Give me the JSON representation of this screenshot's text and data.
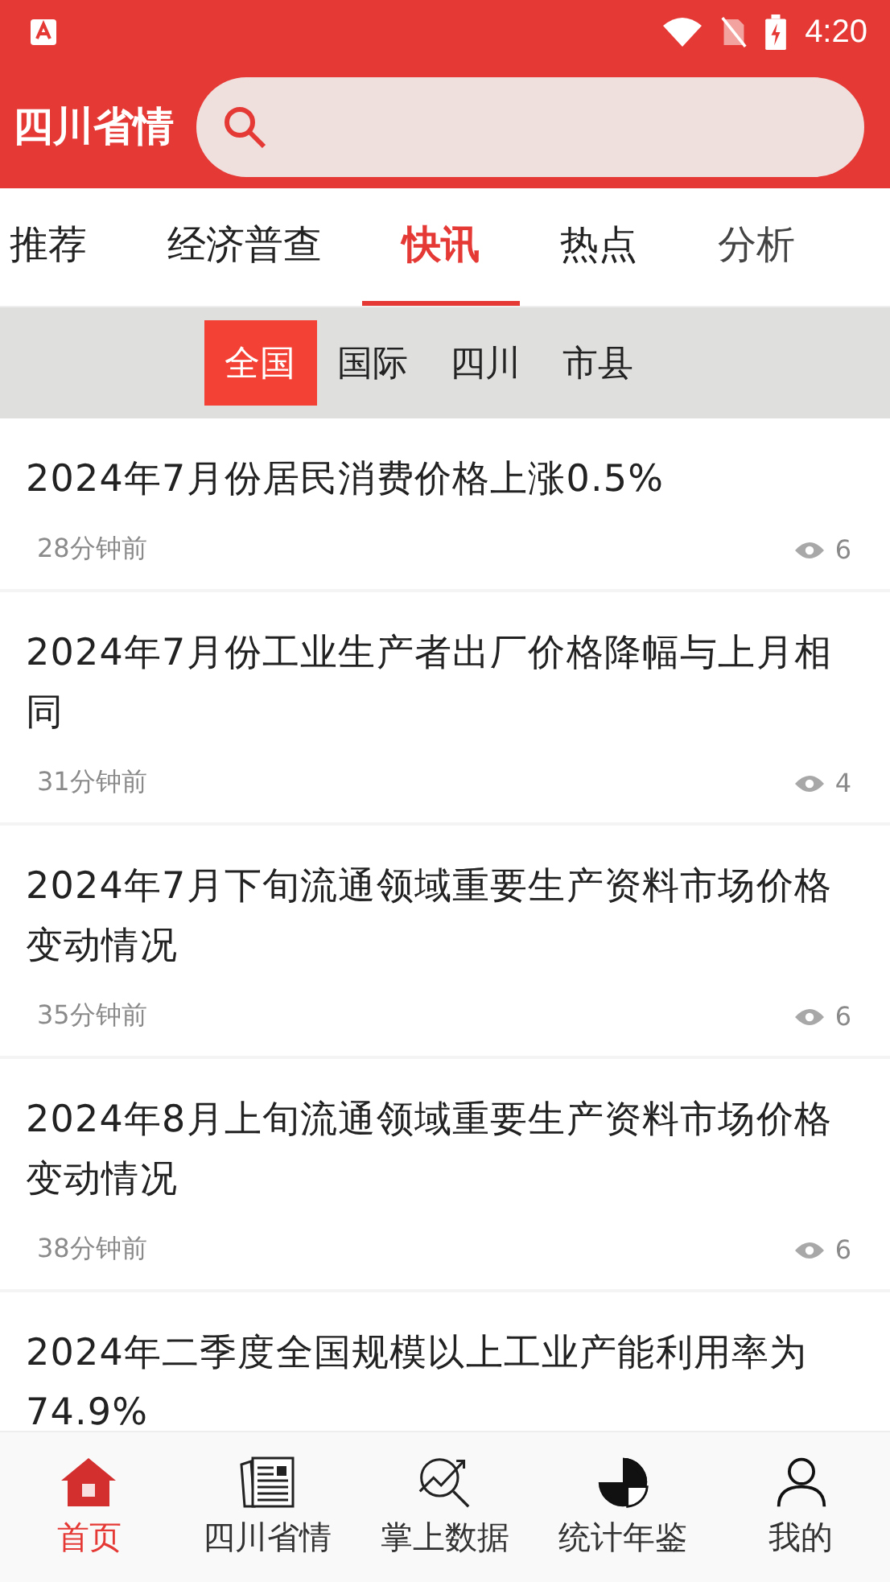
{
  "status_bar": {
    "time": "4:20"
  },
  "header": {
    "title": "四川省情"
  },
  "tabs": [
    {
      "label": "推荐",
      "selected": false
    },
    {
      "label": "经济普查",
      "selected": false
    },
    {
      "label": "快讯",
      "selected": true
    },
    {
      "label": "热点",
      "selected": false
    },
    {
      "label": "分析",
      "selected": false
    }
  ],
  "regions": [
    {
      "label": "全国",
      "selected": true
    },
    {
      "label": "国际",
      "selected": false
    },
    {
      "label": "四川",
      "selected": false
    },
    {
      "label": "市县",
      "selected": false
    }
  ],
  "articles": [
    {
      "title": "2024年7月份居民消费价格上涨0.5%",
      "time": "28分钟前",
      "views": "6"
    },
    {
      "title": "2024年7月份工业生产者出厂价格降幅与上月相同",
      "time": "31分钟前",
      "views": "4"
    },
    {
      "title": "2024年7月下旬流通领域重要生产资料市场价格变动情况",
      "time": "35分钟前",
      "views": "6"
    },
    {
      "title": "2024年8月上旬流通领域重要生产资料市场价格变动情况",
      "time": "38分钟前",
      "views": "6"
    },
    {
      "title": "2024年二季度全国规模以上工业产能利用率为74.9%"
    }
  ],
  "bottom_nav": [
    {
      "kind": "home",
      "label": "首页",
      "selected": true
    },
    {
      "kind": "news",
      "label": "四川省情",
      "selected": false
    },
    {
      "kind": "data",
      "label": "掌上数据",
      "selected": false
    },
    {
      "kind": "yearbook",
      "label": "统计年鉴",
      "selected": false
    },
    {
      "kind": "me",
      "label": "我的",
      "selected": false
    }
  ]
}
